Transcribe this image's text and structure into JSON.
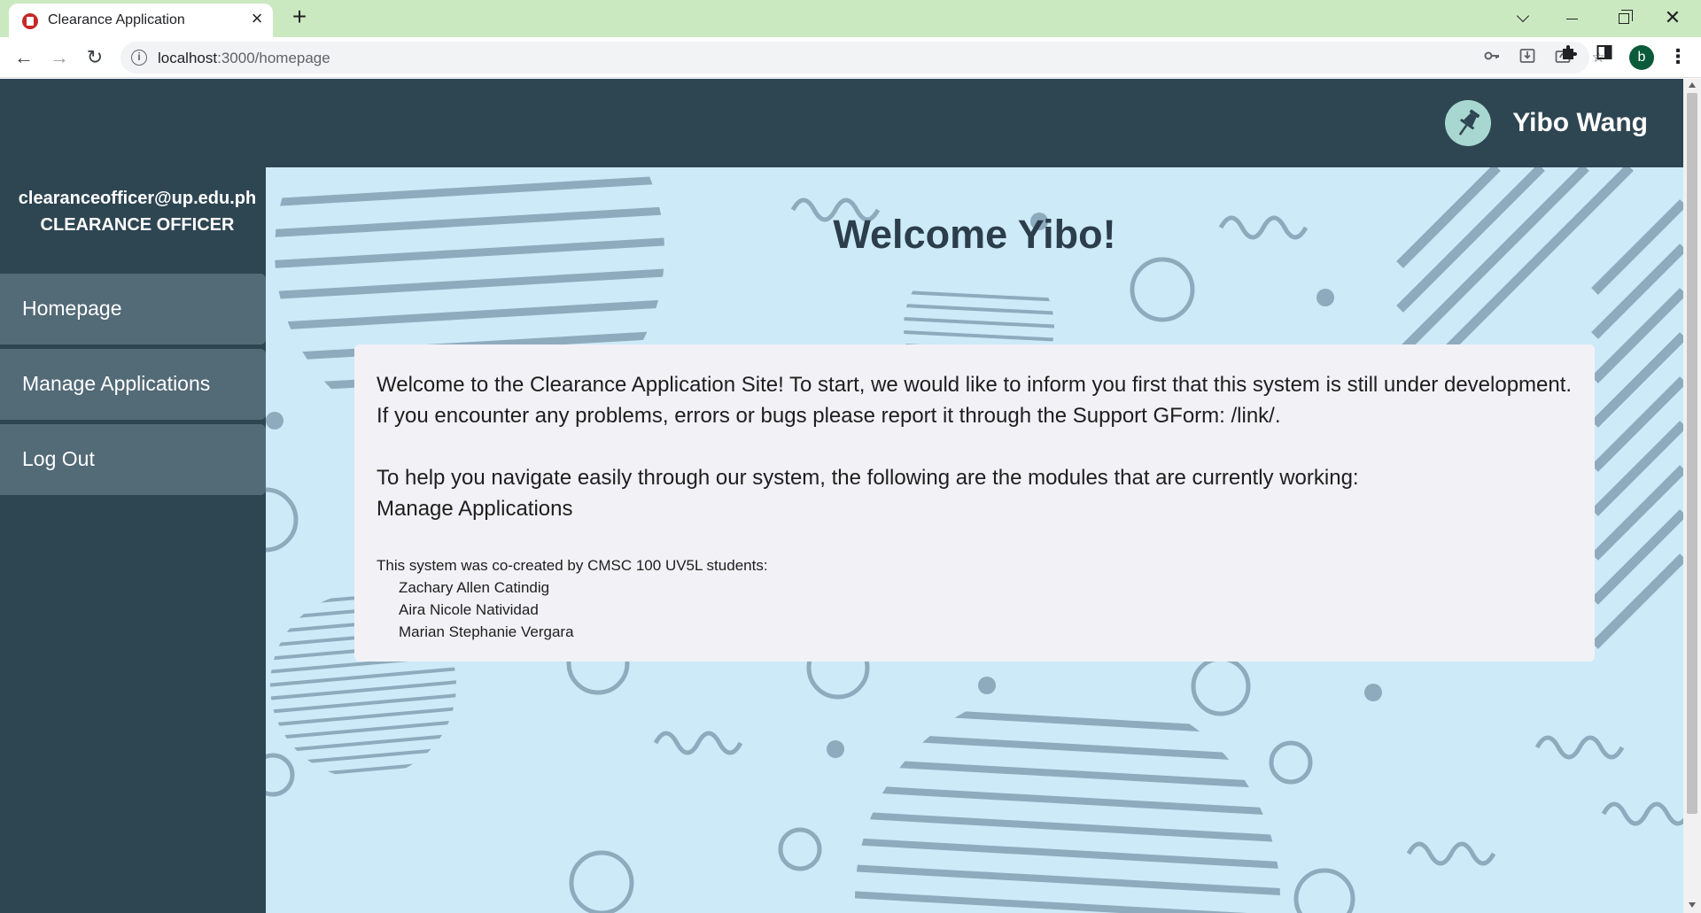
{
  "browser": {
    "tab_title": "Clearance Application",
    "url_host": "localhost",
    "url_path": ":3000/homepage",
    "profile_initial": "b"
  },
  "header": {
    "user_name": "Yibo Wang"
  },
  "sidebar": {
    "email": "clearanceofficer@up.edu.ph",
    "role": "CLEARANCE OFFICER",
    "items": [
      {
        "label": "Homepage"
      },
      {
        "label": "Manage Applications"
      },
      {
        "label": "Log Out"
      }
    ]
  },
  "main": {
    "welcome_title": "Welcome Yibo!",
    "intro": "Welcome to the Clearance Application Site! To start, we would like to inform you first that this system is still under development. If you encounter any problems, errors or bugs please report it through the Support GForm: /link/.",
    "modules_intro": "To help you navigate easily through our system, the following are the modules that are currently working:",
    "modules": [
      "Manage Applications"
    ],
    "credits_intro": "This system was co-created by CMSC 100 UV5L students:",
    "creators": [
      "Zachary Allen Catindig",
      "Aira Nicole Natividad",
      "Marian Stephanie Vergara"
    ]
  },
  "colors": {
    "header_bg": "#2e4552",
    "sidebar_item_bg": "#536a77",
    "main_bg": "#cdeaf8",
    "card_bg": "#f2f2f6",
    "deco": "#8eabbd"
  }
}
